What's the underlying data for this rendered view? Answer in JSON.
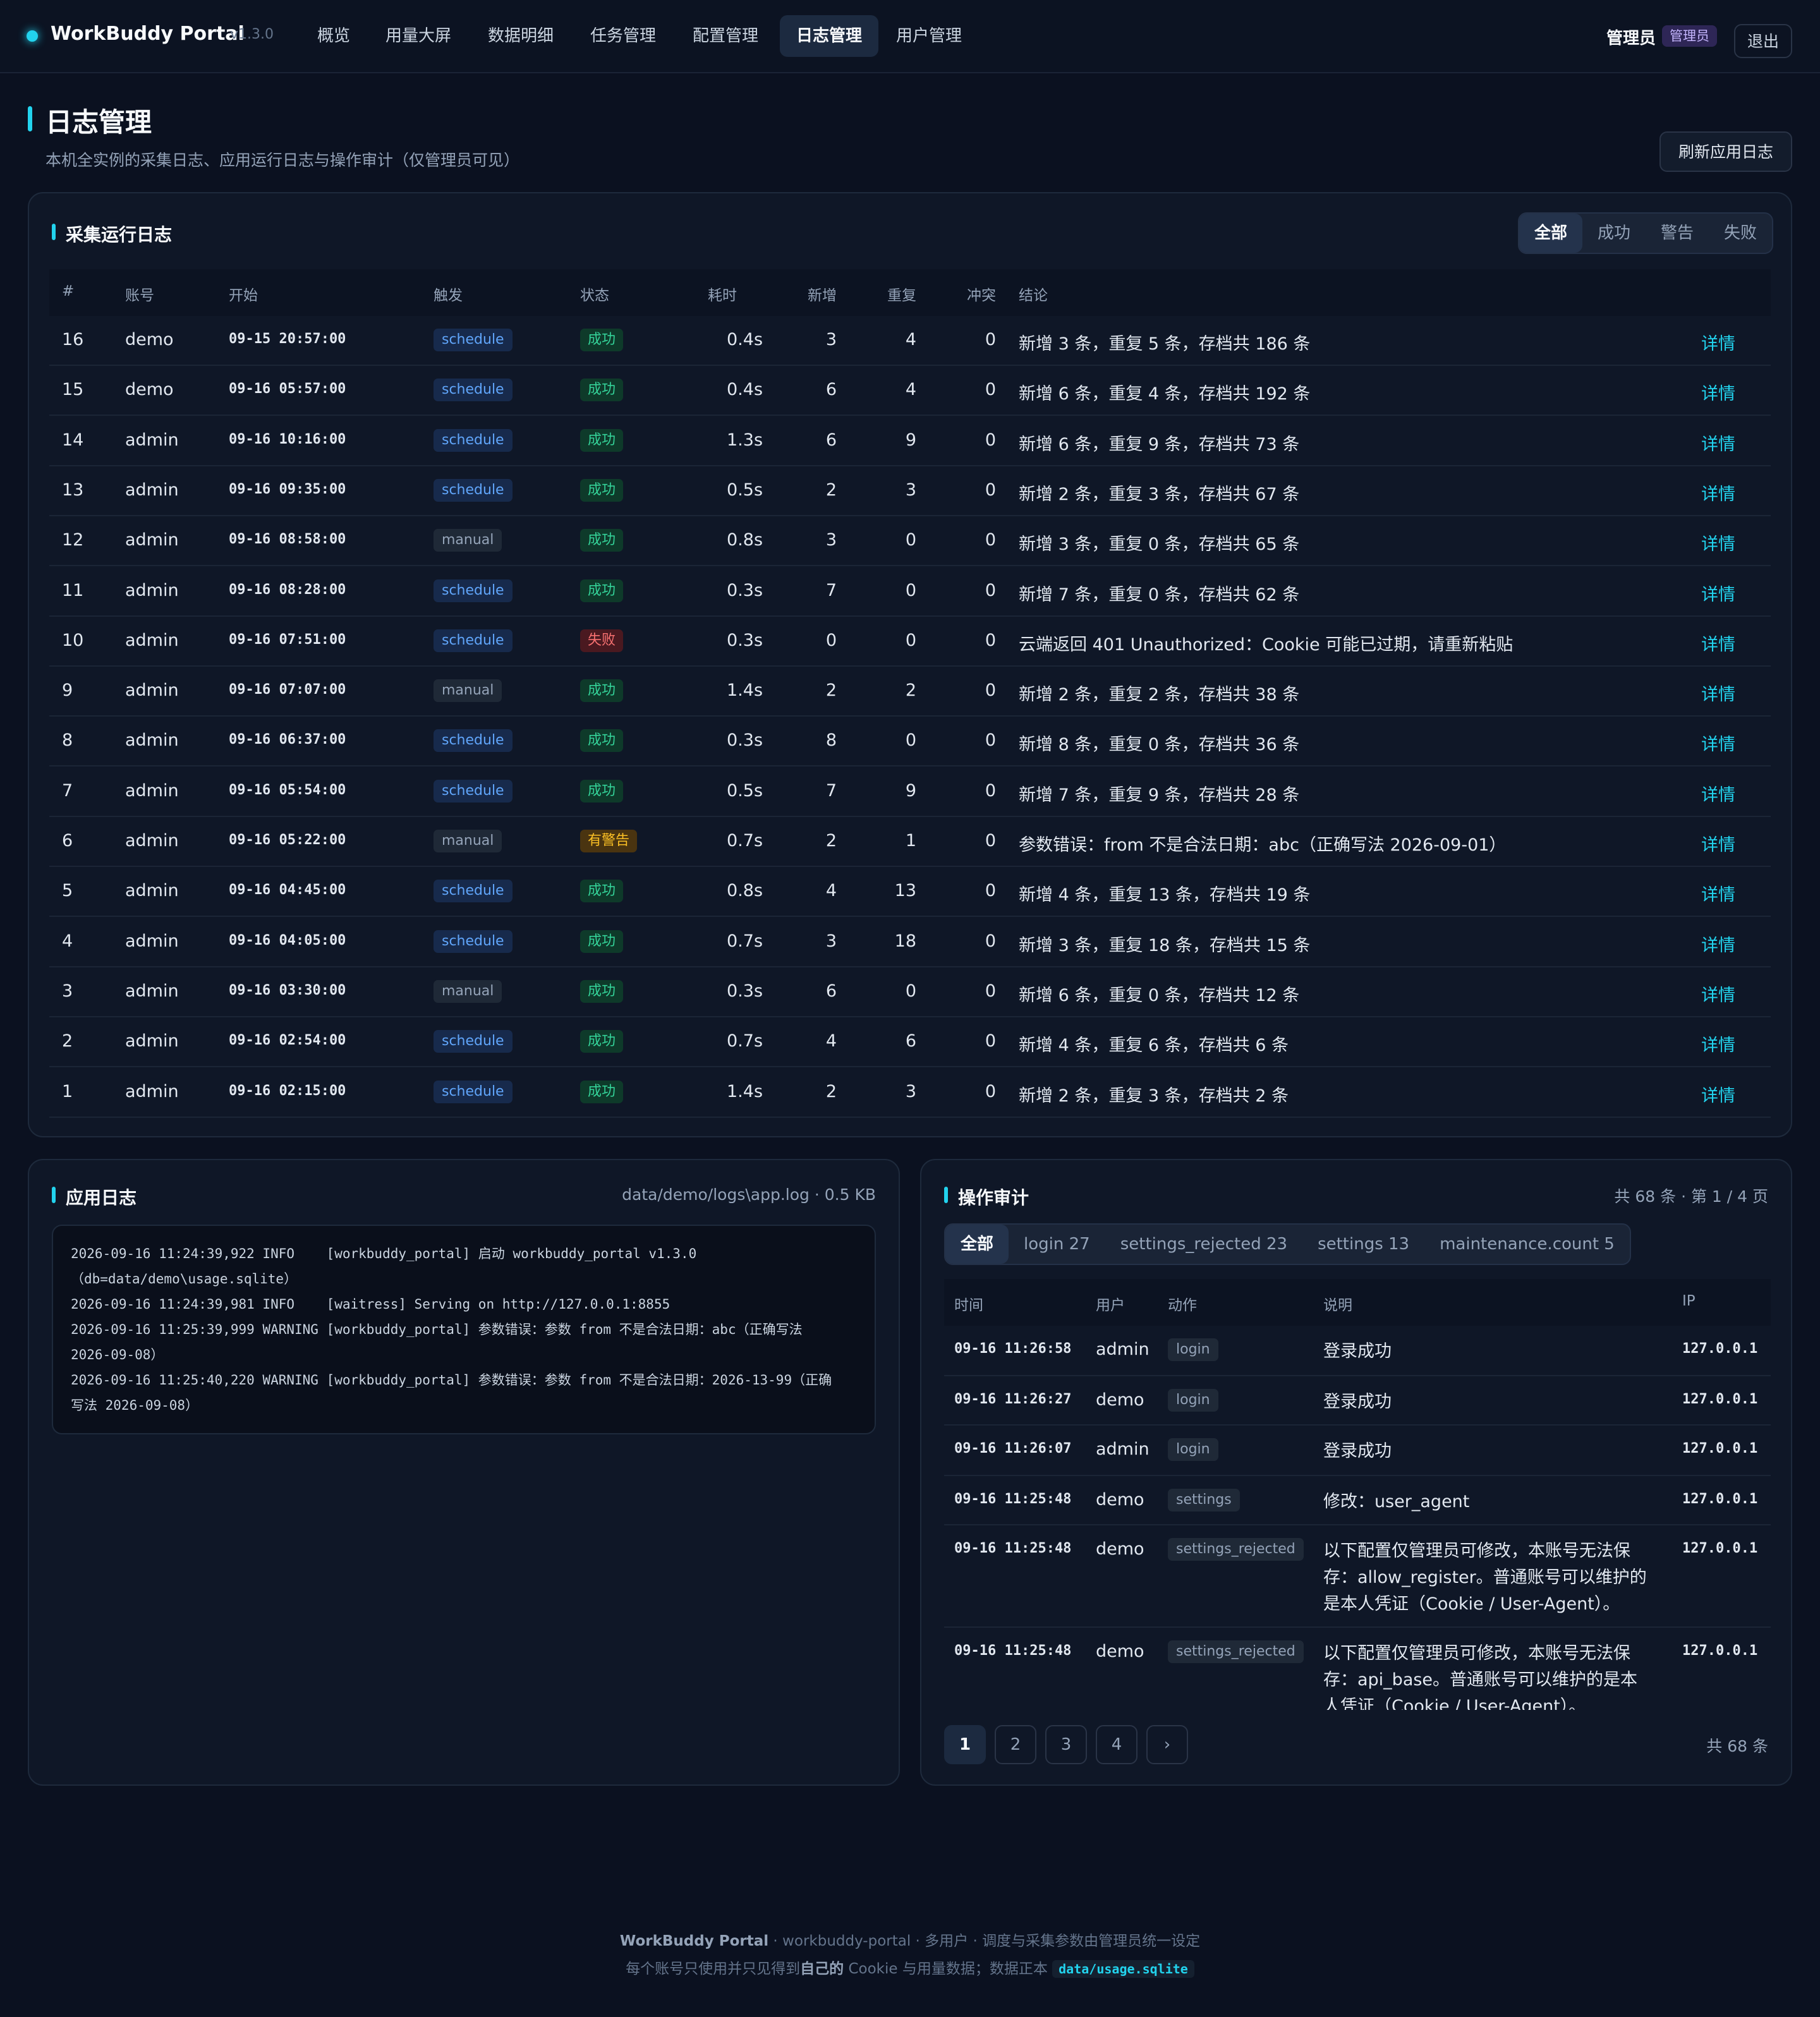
{
  "nav": {
    "brand": "WorkBuddy Portal",
    "version": "v1.3.0",
    "tabs": [
      "概览",
      "用量大屏",
      "数据明细",
      "任务管理",
      "配置管理",
      "日志管理",
      "用户管理"
    ],
    "active_tab": "日志管理",
    "user_name": "管理员",
    "user_badge": "管理员",
    "logout": "退出"
  },
  "page": {
    "title": "日志管理",
    "subtitle": "本机全实例的采集日志、应用运行日志与操作审计（仅管理员可见）",
    "refresh_button": "刷新应用日志"
  },
  "runs": {
    "title": "采集运行日志",
    "filters": [
      "全部",
      "成功",
      "警告",
      "失败"
    ],
    "active_filter": "全部",
    "columns": [
      "#",
      "账号",
      "开始",
      "触发",
      "状态",
      "耗时",
      "新增",
      "重复",
      "冲突",
      "结论"
    ],
    "detail_label": "详情",
    "rows": [
      {
        "id": "16",
        "account": "demo",
        "start": "09-15 20:57:00",
        "trigger": "schedule",
        "status": "成功",
        "status_type": "ok",
        "duration": "0.4s",
        "added": "3",
        "dup": "4",
        "conflict": "0",
        "summary": "新增 3 条，重复 5 条，存档共 186 条"
      },
      {
        "id": "15",
        "account": "demo",
        "start": "09-16 05:57:00",
        "trigger": "schedule",
        "status": "成功",
        "status_type": "ok",
        "duration": "0.4s",
        "added": "6",
        "dup": "4",
        "conflict": "0",
        "summary": "新增 6 条，重复 4 条，存档共 192 条"
      },
      {
        "id": "14",
        "account": "admin",
        "start": "09-16 10:16:00",
        "trigger": "schedule",
        "status": "成功",
        "status_type": "ok",
        "duration": "1.3s",
        "added": "6",
        "dup": "9",
        "conflict": "0",
        "summary": "新增 6 条，重复 9 条，存档共 73 条"
      },
      {
        "id": "13",
        "account": "admin",
        "start": "09-16 09:35:00",
        "trigger": "schedule",
        "status": "成功",
        "status_type": "ok",
        "duration": "0.5s",
        "added": "2",
        "dup": "3",
        "conflict": "0",
        "summary": "新增 2 条，重复 3 条，存档共 67 条"
      },
      {
        "id": "12",
        "account": "admin",
        "start": "09-16 08:58:00",
        "trigger": "manual",
        "status": "成功",
        "status_type": "ok",
        "duration": "0.8s",
        "added": "3",
        "dup": "0",
        "conflict": "0",
        "summary": "新增 3 条，重复 0 条，存档共 65 条"
      },
      {
        "id": "11",
        "account": "admin",
        "start": "09-16 08:28:00",
        "trigger": "schedule",
        "status": "成功",
        "status_type": "ok",
        "duration": "0.3s",
        "added": "7",
        "dup": "0",
        "conflict": "0",
        "summary": "新增 7 条，重复 0 条，存档共 62 条"
      },
      {
        "id": "10",
        "account": "admin",
        "start": "09-16 07:51:00",
        "trigger": "schedule",
        "status": "失败",
        "status_type": "fail",
        "duration": "0.3s",
        "added": "0",
        "dup": "0",
        "conflict": "0",
        "summary": "云端返回 401 Unauthorized：Cookie 可能已过期，请重新粘贴"
      },
      {
        "id": "9",
        "account": "admin",
        "start": "09-16 07:07:00",
        "trigger": "manual",
        "status": "成功",
        "status_type": "ok",
        "duration": "1.4s",
        "added": "2",
        "dup": "2",
        "conflict": "0",
        "summary": "新增 2 条，重复 2 条，存档共 38 条"
      },
      {
        "id": "8",
        "account": "admin",
        "start": "09-16 06:37:00",
        "trigger": "schedule",
        "status": "成功",
        "status_type": "ok",
        "duration": "0.3s",
        "added": "8",
        "dup": "0",
        "conflict": "0",
        "summary": "新增 8 条，重复 0 条，存档共 36 条"
      },
      {
        "id": "7",
        "account": "admin",
        "start": "09-16 05:54:00",
        "trigger": "schedule",
        "status": "成功",
        "status_type": "ok",
        "duration": "0.5s",
        "added": "7",
        "dup": "9",
        "conflict": "0",
        "summary": "新增 7 条，重复 9 条，存档共 28 条"
      },
      {
        "id": "6",
        "account": "admin",
        "start": "09-16 05:22:00",
        "trigger": "manual",
        "status": "有警告",
        "status_type": "warn",
        "duration": "0.7s",
        "added": "2",
        "dup": "1",
        "conflict": "0",
        "summary": "参数错误：from 不是合法日期：abc（正确写法 2026-09-01）"
      },
      {
        "id": "5",
        "account": "admin",
        "start": "09-16 04:45:00",
        "trigger": "schedule",
        "status": "成功",
        "status_type": "ok",
        "duration": "0.8s",
        "added": "4",
        "dup": "13",
        "conflict": "0",
        "summary": "新增 4 条，重复 13 条，存档共 19 条"
      },
      {
        "id": "4",
        "account": "admin",
        "start": "09-16 04:05:00",
        "trigger": "schedule",
        "status": "成功",
        "status_type": "ok",
        "duration": "0.7s",
        "added": "3",
        "dup": "18",
        "conflict": "0",
        "summary": "新增 3 条，重复 18 条，存档共 15 条"
      },
      {
        "id": "3",
        "account": "admin",
        "start": "09-16 03:30:00",
        "trigger": "manual",
        "status": "成功",
        "status_type": "ok",
        "duration": "0.3s",
        "added": "6",
        "dup": "0",
        "conflict": "0",
        "summary": "新增 6 条，重复 0 条，存档共 12 条"
      },
      {
        "id": "2",
        "account": "admin",
        "start": "09-16 02:54:00",
        "trigger": "schedule",
        "status": "成功",
        "status_type": "ok",
        "duration": "0.7s",
        "added": "4",
        "dup": "6",
        "conflict": "0",
        "summary": "新增 4 条，重复 6 条，存档共 6 条"
      },
      {
        "id": "1",
        "account": "admin",
        "start": "09-16 02:15:00",
        "trigger": "schedule",
        "status": "成功",
        "status_type": "ok",
        "duration": "1.4s",
        "added": "2",
        "dup": "3",
        "conflict": "0",
        "summary": "新增 2 条，重复 3 条，存档共 2 条"
      }
    ]
  },
  "applog": {
    "title": "应用日志",
    "path": "data/demo/logs\\app.log · 0.5 KB",
    "lines": [
      "2026-09-16 11:24:39,922 INFO    [workbuddy_portal] 启动 workbuddy_portal v1.3.0\n（db=data/demo\\usage.sqlite）",
      "2026-09-16 11:24:39,981 INFO    [waitress] Serving on http://127.0.0.1:8855",
      "2026-09-16 11:25:39,999 WARNING [workbuddy_portal] 参数错误：参数 from 不是合法日期：abc（正确写法\n2026-09-08）",
      "2026-09-16 11:25:40,220 WARNING [workbuddy_portal] 参数错误：参数 from 不是合法日期：2026-13-99（正确\n写法 2026-09-08）"
    ]
  },
  "audit": {
    "title": "操作审计",
    "summary": "共 68 条 · 第 1 / 4 页",
    "filters": [
      "全部",
      "login 27",
      "settings_rejected 23",
      "settings 13",
      "maintenance.count 5"
    ],
    "active_filter": "全部",
    "columns": [
      "时间",
      "用户",
      "动作",
      "说明",
      "IP"
    ],
    "rows": [
      {
        "time": "09-16 11:26:58",
        "user": "admin",
        "action": "login",
        "desc": "登录成功",
        "ip": "127.0.0.1"
      },
      {
        "time": "09-16 11:26:27",
        "user": "demo",
        "action": "login",
        "desc": "登录成功",
        "ip": "127.0.0.1"
      },
      {
        "time": "09-16 11:26:07",
        "user": "admin",
        "action": "login",
        "desc": "登录成功",
        "ip": "127.0.0.1"
      },
      {
        "time": "09-16 11:25:48",
        "user": "demo",
        "action": "settings",
        "desc": "修改：user_agent",
        "ip": "127.0.0.1"
      },
      {
        "time": "09-16 11:25:48",
        "user": "demo",
        "action": "settings_rejected",
        "desc": "以下配置仅管理员可修改，本账号无法保存：allow_register。普通账号可以维护的是本人凭证（Cookie / User-Agent）。",
        "ip": "127.0.0.1"
      },
      {
        "time": "09-16 11:25:48",
        "user": "demo",
        "action": "settings_rejected",
        "desc": "以下配置仅管理员可修改，本账号无法保存：api_base。普通账号可以维护的是本人凭证（Cookie / User-Agent）。",
        "ip": "127.0.0.1"
      }
    ],
    "pages": [
      "1",
      "2",
      "3",
      "4",
      "›"
    ],
    "active_page": "1",
    "total": "共 68 条"
  },
  "footer": {
    "brand": "WorkBuddy Portal",
    "line1_rest": " · workbuddy-portal · 多用户 · 调度与采集参数由管理员统一设定",
    "line2_pre": "每个账号只使用并只见得到",
    "line2_bold": "自己的",
    "line2_mid": " Cookie 与用量数据；数据正本 ",
    "line2_code": "data/usage.sqlite"
  }
}
